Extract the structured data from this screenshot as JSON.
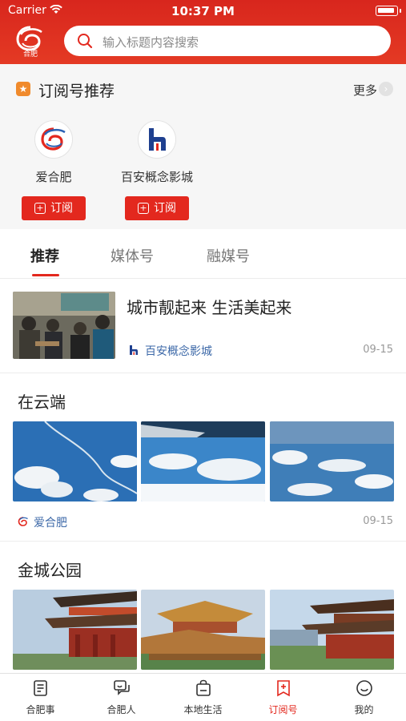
{
  "status_bar": {
    "carrier": "Carrier",
    "time": "10:37 PM"
  },
  "header": {
    "logo_text": "合肥",
    "search_placeholder": "输入标题内容搜索"
  },
  "recommend": {
    "title": "订阅号推荐",
    "more_label": "更多",
    "accounts": [
      {
        "name": "爱合肥",
        "subscribe_label": "订阅"
      },
      {
        "name": "百安概念影城",
        "subscribe_label": "订阅"
      }
    ]
  },
  "tabs": [
    {
      "label": "推荐",
      "active": true
    },
    {
      "label": "媒体号",
      "active": false
    },
    {
      "label": "融媒号",
      "active": false
    }
  ],
  "feed": {
    "article": {
      "title": "城市靓起来 生活美起来",
      "source": "百安概念影城",
      "date": "09-15"
    },
    "gallery1": {
      "title": "在云端",
      "source": "爱合肥",
      "date": "09-15"
    },
    "gallery2": {
      "title": "金城公园"
    }
  },
  "bottom_nav": [
    {
      "label": "合肥事",
      "icon": "document-icon",
      "active": false
    },
    {
      "label": "合肥人",
      "icon": "chat-icon",
      "active": false
    },
    {
      "label": "本地生活",
      "icon": "bag-icon",
      "active": false
    },
    {
      "label": "订阅号",
      "icon": "bookmark-add-icon",
      "active": true
    },
    {
      "label": "我的",
      "icon": "smile-icon",
      "active": false
    }
  ],
  "colors": {
    "brand_red": "#e3281e",
    "link_blue": "#3d69a8",
    "orange": "#f08a2c"
  }
}
